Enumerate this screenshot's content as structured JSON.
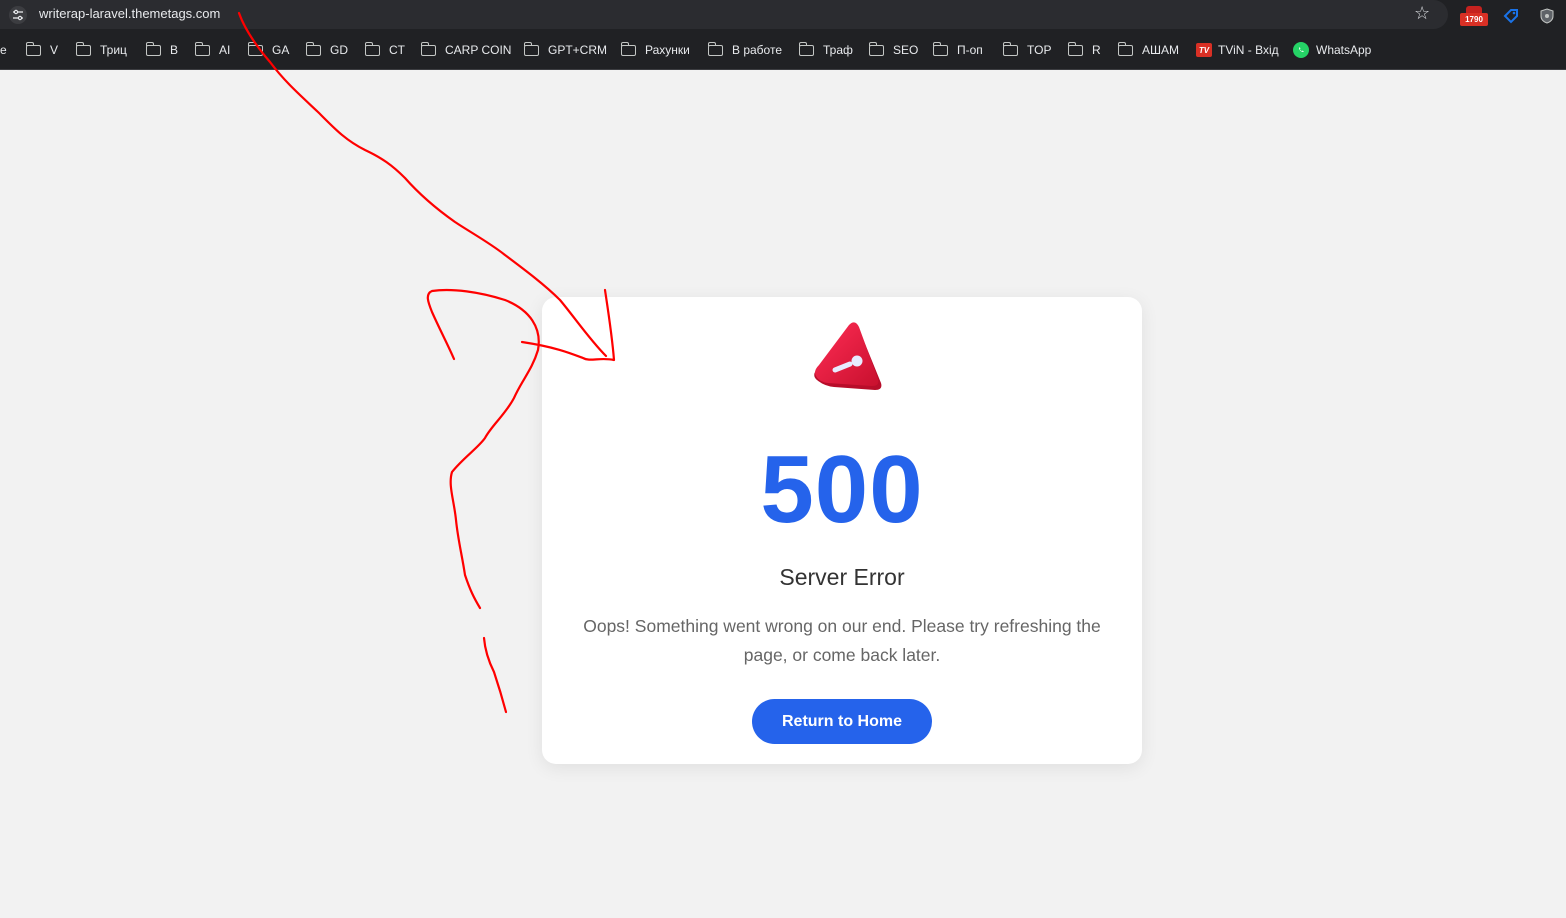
{
  "browser": {
    "url": "writerap-laravel.themetags.com",
    "extension_badge": "1790"
  },
  "bookmarks": [
    {
      "label": "е",
      "type": "partial"
    },
    {
      "label": "V",
      "type": "folder"
    },
    {
      "label": "Триц",
      "type": "folder"
    },
    {
      "label": "B",
      "type": "folder"
    },
    {
      "label": "AI",
      "type": "folder"
    },
    {
      "label": "GA",
      "type": "folder"
    },
    {
      "label": "GD",
      "type": "folder"
    },
    {
      "label": "CT",
      "type": "folder"
    },
    {
      "label": "CARP COIN",
      "type": "folder"
    },
    {
      "label": "GPT+CRM",
      "type": "folder"
    },
    {
      "label": "Рахунки",
      "type": "folder"
    },
    {
      "label": "В работе",
      "type": "folder"
    },
    {
      "label": "Траф",
      "type": "folder"
    },
    {
      "label": "SEO",
      "type": "folder"
    },
    {
      "label": "П-оп",
      "type": "folder"
    },
    {
      "label": "TOP",
      "type": "folder"
    },
    {
      "label": "R",
      "type": "folder"
    },
    {
      "label": "АШАМ",
      "type": "folder"
    },
    {
      "label": "TViN - Вхід",
      "type": "site",
      "icon": "tvin-icon"
    },
    {
      "label": "WhatsApp",
      "type": "site",
      "icon": "whatsapp-icon"
    }
  ],
  "error_page": {
    "icon": "warning-triangle-icon",
    "code": "500",
    "title": "Server Error",
    "message": "Oops! Something went wrong on our end. Please try refreshing the page, or come back later.",
    "button_label": "Return to Home"
  },
  "colors": {
    "accent": "#2563eb",
    "icon_red": "#e11d48",
    "annotation": "#ff0000",
    "page_bg": "#f2f2f2"
  }
}
